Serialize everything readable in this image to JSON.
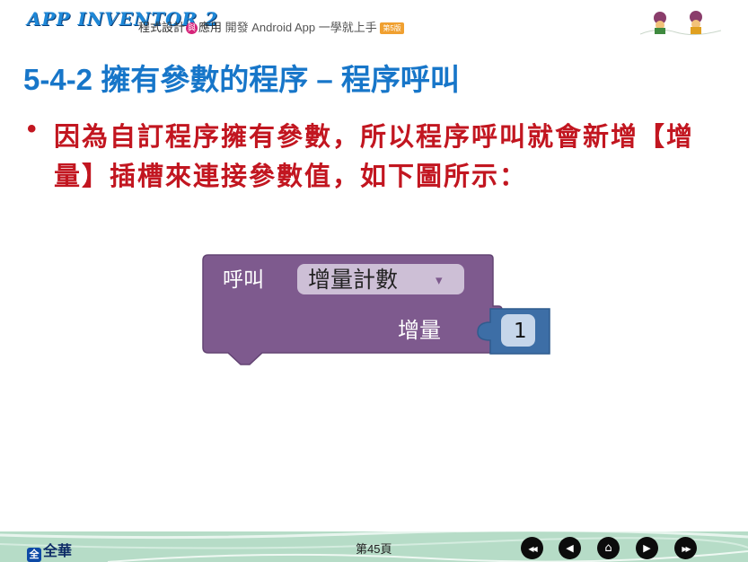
{
  "header": {
    "logo": "APP INVENTOR 2",
    "book_title_a": "程式設計",
    "circle": "與",
    "book_title_b": "應用",
    "book_subtitle": " 開發 Android App 一學就上手",
    "tag": "第5版"
  },
  "slide": {
    "title": "5-4-2 擁有參數的程序 – 程序呼叫",
    "bullet": "•",
    "body": "因為自訂程序擁有參數，所以程序呼叫就會新增【增量】插槽來連接參數值，如下圖所示："
  },
  "block": {
    "call_label": "呼叫",
    "procedure_name": "增量計數",
    "dropdown_arrow": "▾",
    "param_label": "增量",
    "param_value": "1",
    "colors": {
      "procedure": "#7e5a8e",
      "number": "#3d6ea6"
    }
  },
  "footer": {
    "brand_mark": "全",
    "brand": "全華",
    "page": "第45頁",
    "nav": [
      {
        "name": "first",
        "glyph": "◀◀"
      },
      {
        "name": "prev",
        "glyph": "◀"
      },
      {
        "name": "home",
        "glyph": "⌂"
      },
      {
        "name": "next",
        "glyph": "▶"
      },
      {
        "name": "last",
        "glyph": "▶▶"
      }
    ]
  }
}
